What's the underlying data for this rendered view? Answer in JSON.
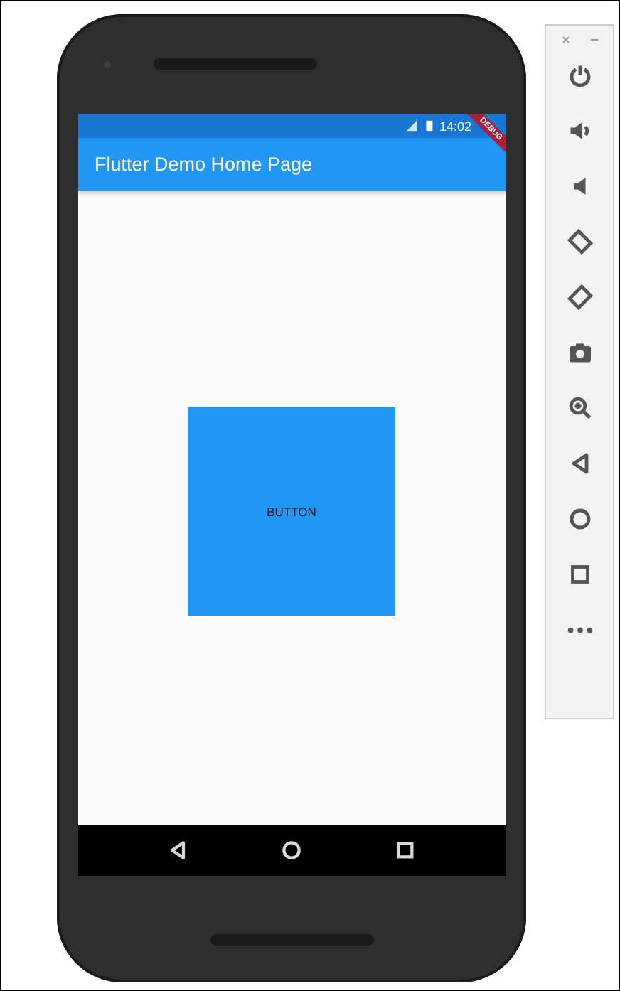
{
  "status_bar": {
    "time": "14:02",
    "debug_banner": "DEBUG"
  },
  "app_bar": {
    "title": "Flutter Demo Home Page"
  },
  "body": {
    "button": {
      "label": "BUTTON"
    }
  },
  "nav_bar": {
    "buttons": [
      {
        "kind": "back"
      },
      {
        "kind": "home"
      },
      {
        "kind": "recents"
      }
    ]
  },
  "emulator_toolbar": {
    "window_controls": [
      {
        "kind": "close"
      },
      {
        "kind": "minimize"
      }
    ],
    "controls": [
      {
        "kind": "power"
      },
      {
        "kind": "volume-up"
      },
      {
        "kind": "volume-down"
      },
      {
        "kind": "rotate-left"
      },
      {
        "kind": "rotate-right"
      },
      {
        "kind": "screenshot"
      },
      {
        "kind": "zoom"
      },
      {
        "kind": "back"
      },
      {
        "kind": "home"
      },
      {
        "kind": "overview"
      },
      {
        "kind": "more"
      }
    ]
  }
}
